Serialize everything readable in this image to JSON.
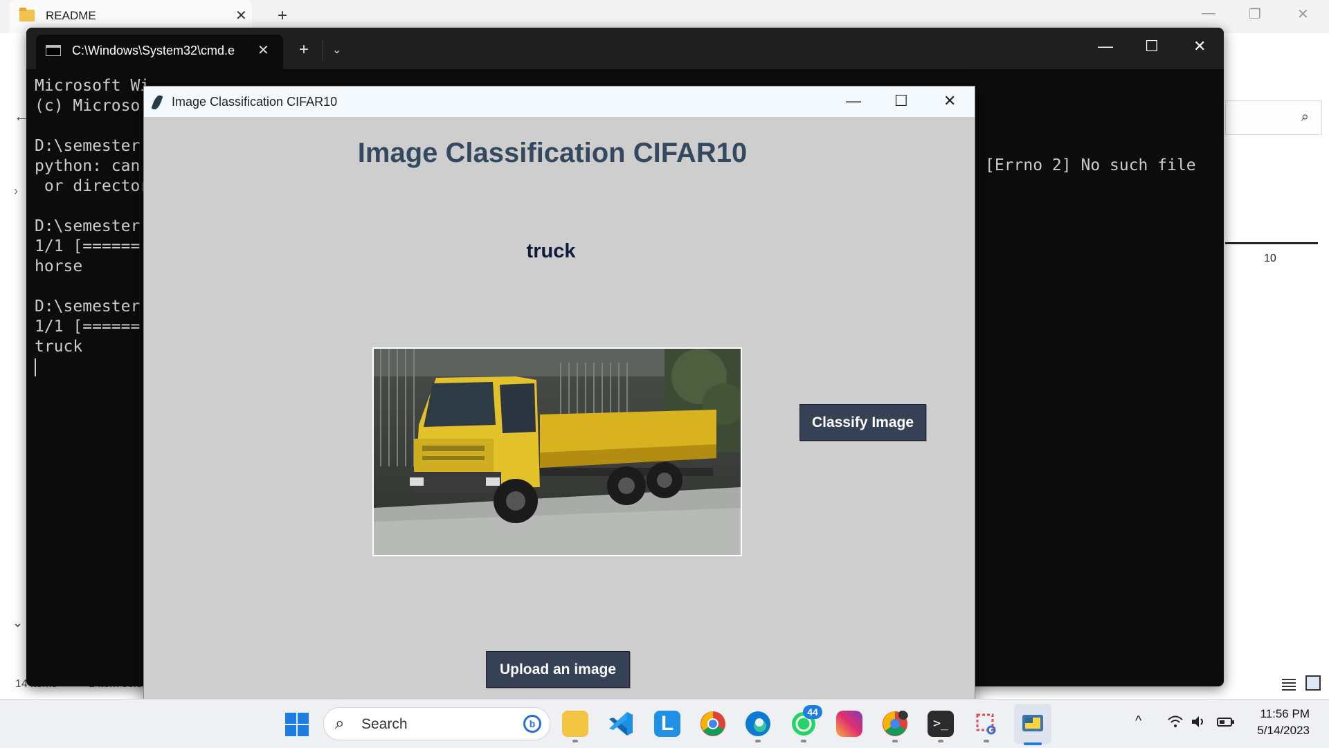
{
  "explorer": {
    "tab_label": "README",
    "new_tab": "+",
    "close": "✕",
    "minimize": "—",
    "restore": "❐",
    "search_icon": "⌕",
    "axis_tick": "10",
    "status_items": "14 items",
    "status_selected": "1 item sele"
  },
  "terminal": {
    "tab_label": "C:\\Windows\\System32\\cmd.e",
    "tab_close": "✕",
    "new_tab": "+",
    "dropdown": "⌄",
    "minimize": "—",
    "maximize": "☐",
    "close": "✕",
    "lines": [
      "Microsoft Wi",
      "(c) Microso",
      "",
      "D:\\semester",
      "python: can",
      " or director",
      "",
      "D:\\semester",
      "1/1 [======",
      "horse",
      "",
      "D:\\semester",
      "1/1 [======",
      "truck"
    ],
    "right_text": "[Errno 2] No such file"
  },
  "app": {
    "window_title": "Image Classification CIFAR10",
    "minimize": "—",
    "maximize": "☐",
    "close": "✕",
    "heading": "Image Classification CIFAR10",
    "result": "truck",
    "classify_button": "Classify Image",
    "upload_button": "Upload an image",
    "image_alt": "yellow truck photo"
  },
  "taskbar": {
    "search_placeholder": "Search",
    "search_icon": "⌕",
    "bing_icon": "b",
    "whatsapp_badge": "44",
    "tray_chevron": "^",
    "wifi_icon": "wifi",
    "volume_icon": "volume",
    "battery_icon": "battery",
    "time": "11:56 PM",
    "date": "5/14/2023"
  },
  "colors": {
    "app_bg": "#cecece",
    "button_bg": "#364156",
    "heading": "#34495e",
    "terminal_bg": "#0c0c0c",
    "accent": "#1e7de0"
  }
}
